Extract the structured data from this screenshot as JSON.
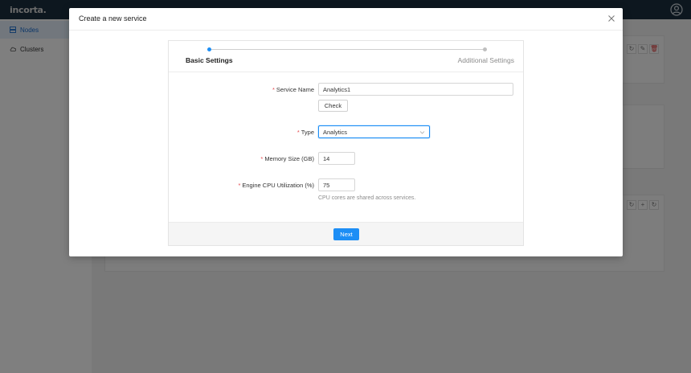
{
  "app": {
    "logo_text": "incorta."
  },
  "sidebar": {
    "items": [
      {
        "label": "Nodes",
        "icon": "nodes-icon",
        "active": true
      },
      {
        "label": "Clusters",
        "icon": "cloud-icon",
        "active": false
      }
    ]
  },
  "modal": {
    "title": "Create a new service",
    "steps": [
      {
        "label": "Basic Settings",
        "state": "current"
      },
      {
        "label": "Additional Settings",
        "state": "pending"
      }
    ],
    "fields": {
      "service_name": {
        "label": "Service Name",
        "value": "Analytics1"
      },
      "check_label": "Check",
      "type": {
        "label": "Type",
        "value": "Analytics"
      },
      "memory": {
        "label": "Memory Size (GB)",
        "value": "14"
      },
      "cpu": {
        "label": "Engine CPU Utilization (%)",
        "value": "75",
        "help": "CPU cores are shared across services."
      }
    },
    "next_label": "Next"
  },
  "colors": {
    "primary": "#1d8ef5",
    "required": "#e5484d",
    "topbar": "#1b2f3f"
  }
}
